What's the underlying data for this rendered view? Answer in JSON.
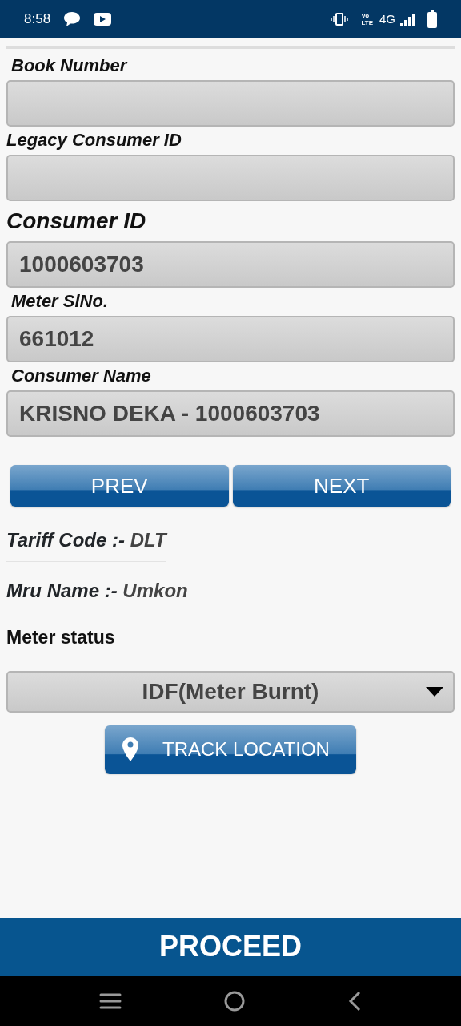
{
  "status_bar": {
    "time": "8:58",
    "volte_top": "Vo",
    "volte_bottom": "LTE",
    "network": "4G"
  },
  "fields": [
    {
      "kind": "label",
      "label": "Book Number"
    },
    {
      "kind": "label",
      "label": "Legacy Consumer ID"
    },
    {
      "kind": "heading",
      "label": "Consumer ID",
      "value": "1000603703"
    },
    {
      "kind": "label",
      "label": "Meter SlNo.",
      "value": "661012"
    },
    {
      "kind": "label",
      "label": "Consumer Name",
      "value": "KRISNO DEKA - 1000603703"
    }
  ],
  "nav_buttons": [
    "PREV",
    "NEXT"
  ],
  "info": [
    {
      "label": "Tariff Code :-",
      "value": "DLT"
    },
    {
      "label": "Mru Name :-",
      "value": "Umkon"
    }
  ],
  "meter_status": {
    "label": "Meter status",
    "value": "IDF(Meter Burnt)"
  },
  "track_button": "TRACK LOCATION",
  "proceed_button": "PROCEED"
}
